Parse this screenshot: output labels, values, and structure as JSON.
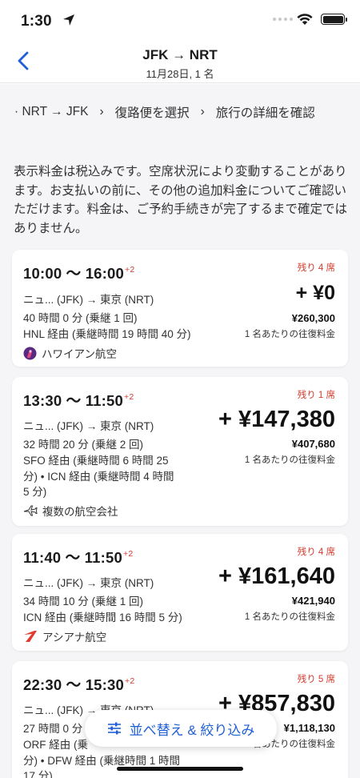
{
  "status_bar": {
    "time": "1:30"
  },
  "header": {
    "title": "JFK → NRT",
    "subtitle": "11月28日, 1 名"
  },
  "breadcrumb": {
    "item1": "· NRT → JFK",
    "item2": "復路便を選択",
    "item3": "旅行の詳細を確認"
  },
  "notice": "表示料金は税込みです。空席状況により変動することがあります。お支払いの前に、その他の追加料金についてご確認いただけます。料金は、ご予約手続きが完了するまで確定ではありません。",
  "flights": [
    {
      "times": "10:00 〜 16:00",
      "day_offset": "+2",
      "seats": "残り 4 席",
      "route": "ニュ... (JFK) → 東京 (NRT)",
      "duration": "40 時間 0 分 (乗継 1 回)",
      "layover": "HNL 経由 (乗継時間 19 時間 40 分)",
      "airline": "ハワイアン航空",
      "price": "+ ¥0",
      "total": "¥260,300",
      "per": "1 名あたりの往復料金"
    },
    {
      "times": "13:30 〜 11:50",
      "day_offset": "+2",
      "seats": "残り 1 席",
      "route": "ニュ... (JFK) → 東京 (NRT)",
      "duration": "32 時間 20 分 (乗継 2 回)",
      "layover_l1": "SFO 経由 (乗継時間 6 時間 25",
      "layover_l2": "分) • ICN 経由 (乗継時間 4 時間",
      "layover_l3": "5 分)",
      "airline": "複数の航空会社",
      "price": "+ ¥147,380",
      "total": "¥407,680",
      "per": "1 名あたりの往復料金"
    },
    {
      "times": "11:40 〜 11:50",
      "day_offset": "+2",
      "seats": "残り 4 席",
      "route": "ニュ... (JFK) → 東京 (NRT)",
      "duration": "34 時間 10 分 (乗継 1 回)",
      "layover": "ICN 経由 (乗継時間 16 時間 5 分)",
      "airline": "アシアナ航空",
      "price": "+ ¥161,640",
      "total": "¥421,940",
      "per": "1 名あたりの往復料金"
    },
    {
      "times": "22:30 〜 15:30",
      "day_offset": "+2",
      "seats": "残り 5 席",
      "route": "ニュ... (JFK) → 東京 (NRT)",
      "duration": "27 時間 0 分",
      "layover_l1": "ORF 経由 (乗",
      "layover_l2": "分) • DFW 経由 (乗継時間 1 時間",
      "layover_l3": "17 分)",
      "price": "+ ¥857,830",
      "total": "¥1,118,130",
      "per": "1 名あたりの往復料金"
    }
  ],
  "sort_filter_button": "並べ替え & 絞り込み",
  "colors": {
    "accent": "#1f5fd6",
    "alert": "#d33a2c",
    "background": "#f5f5f7"
  }
}
